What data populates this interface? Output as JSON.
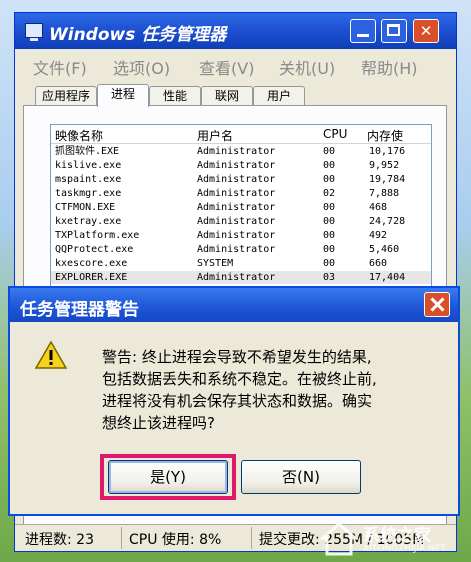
{
  "window": {
    "title": "Windows 任务管理器",
    "menu": [
      "文件(F)",
      "选项(O)",
      "查看(V)",
      "关机(U)",
      "帮助(H)"
    ],
    "tabs": [
      "应用程序",
      "进程",
      "性能",
      "联网",
      "用户"
    ],
    "active_tab": "进程"
  },
  "process_table": {
    "columns": [
      "映像名称",
      "用户名",
      "CPU",
      "内存使"
    ],
    "rows": [
      {
        "name": "抓图软件.EXE",
        "user": "Administrator",
        "cpu": "00",
        "mem": "10,176"
      },
      {
        "name": "kislive.exe",
        "user": "Administrator",
        "cpu": "00",
        "mem": "9,952"
      },
      {
        "name": "mspaint.exe",
        "user": "Administrator",
        "cpu": "00",
        "mem": "19,784"
      },
      {
        "name": "taskmgr.exe",
        "user": "Administrator",
        "cpu": "02",
        "mem": "7,888"
      },
      {
        "name": "CTFMON.EXE",
        "user": "Administrator",
        "cpu": "00",
        "mem": "468"
      },
      {
        "name": "kxetray.exe",
        "user": "Administrator",
        "cpu": "00",
        "mem": "24,728"
      },
      {
        "name": "TXPlatform.exe",
        "user": "Administrator",
        "cpu": "00",
        "mem": "492"
      },
      {
        "name": "QQProtect.exe",
        "user": "Administrator",
        "cpu": "00",
        "mem": "5,460"
      },
      {
        "name": "kxescore.exe",
        "user": "SYSTEM",
        "cpu": "00",
        "mem": "660"
      },
      {
        "name": "EXPLORER.EXE",
        "user": "Administrator",
        "cpu": "03",
        "mem": "17,404"
      }
    ]
  },
  "statusbar": {
    "processes": "进程数: 23",
    "cpu": "CPU 使用: 8%",
    "commit": "提交更改: 255M / 1005M"
  },
  "dialog": {
    "title": "任务管理器警告",
    "message_lines": [
      "警告: 终止进程会导致不希望发生的结果,",
      "包括数据丢失和系统不稳定。在被终止前,",
      "进程将没有机会保存其状态和数据。确实",
      "想终止该进程吗?"
    ],
    "yes_label": "是(Y)",
    "no_label": "否(N)",
    "highlight_color": "#e0186c"
  },
  "watermark": {
    "text": "系统之家",
    "url": "XITONGZHIJIA.NET"
  }
}
